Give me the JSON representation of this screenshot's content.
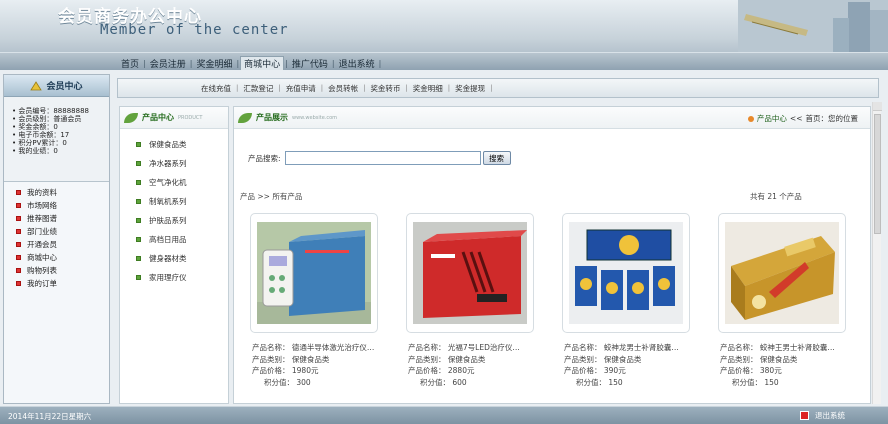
{
  "header": {
    "title_cn": "会员商务办公中心",
    "title_en": "Member of the center"
  },
  "nav": {
    "items": [
      "首页",
      "会员注册",
      "奖金明细",
      "商城中心",
      "推广代码",
      "退出系统"
    ],
    "active": "商城中心"
  },
  "member_panel": {
    "title": "会员中心",
    "info": [
      "• 会员编号：88888888",
      "• 会员级别：普通会员",
      "• 奖金余额：0",
      "• 电子币余额：17",
      "• 积分PV累计：0",
      "• 我的业绩：0"
    ],
    "menu": [
      "我的资料",
      "市场网络",
      "推荐图谱",
      "部门业绩",
      "开通会员",
      "商城中心",
      "购物列表",
      "我的订单"
    ]
  },
  "subnav": {
    "items": [
      "在线充值",
      "汇款登记",
      "充值申请",
      "会员转帐",
      "奖金转币",
      "奖金明细",
      "奖金提现"
    ]
  },
  "product_center": {
    "title": "产品中心",
    "subtitle": "PRODUCT",
    "categories": [
      "保健食品类",
      "净水器系列",
      "空气净化机",
      "制氧机系列",
      "护肤品系列",
      "高档日用品",
      "健身器材类",
      "家用理疗仪"
    ]
  },
  "product_display": {
    "title": "产品展示",
    "subtitle": "www.website.com",
    "breadcrumb": {
      "center": "产品中心",
      "sep": "<<",
      "home": "首页",
      "tail": "：您的位置"
    },
    "search_label": "产品搜索:",
    "search_value": "",
    "search_button": "搜索",
    "list_head": "产品 >> 所有产品",
    "count_text": "共有  21 个产品",
    "products": [
      {
        "name": "产品名称：  德通半导体激光治疗仪…",
        "category": "产品类别：  保健食品类",
        "price": "产品价格：  1980元",
        "points": "积分值：  300"
      },
      {
        "name": "产品名称：  光福7号LED治疗仪…",
        "category": "产品类别：  保健食品类",
        "price": "产品价格：  2880元",
        "points": "积分值：  600"
      },
      {
        "name": "产品名称：  蛟神龙男士补肾胶囊…",
        "category": "产品类别：  保健食品类",
        "price": "产品价格：  390元",
        "points": "积分值：  150"
      },
      {
        "name": "产品名称：  蛟神王男士补肾胶囊…",
        "category": "产品类别：  保健食品类",
        "price": "产品价格：  380元",
        "points": "积分值：  150"
      }
    ]
  },
  "footer": {
    "date": "2014年11月22日星期六",
    "logout": "退出系统"
  },
  "colors": {
    "accent_green": "#5da33a",
    "accent_red": "#d33333",
    "nav_bg": "#8fa2b1"
  }
}
